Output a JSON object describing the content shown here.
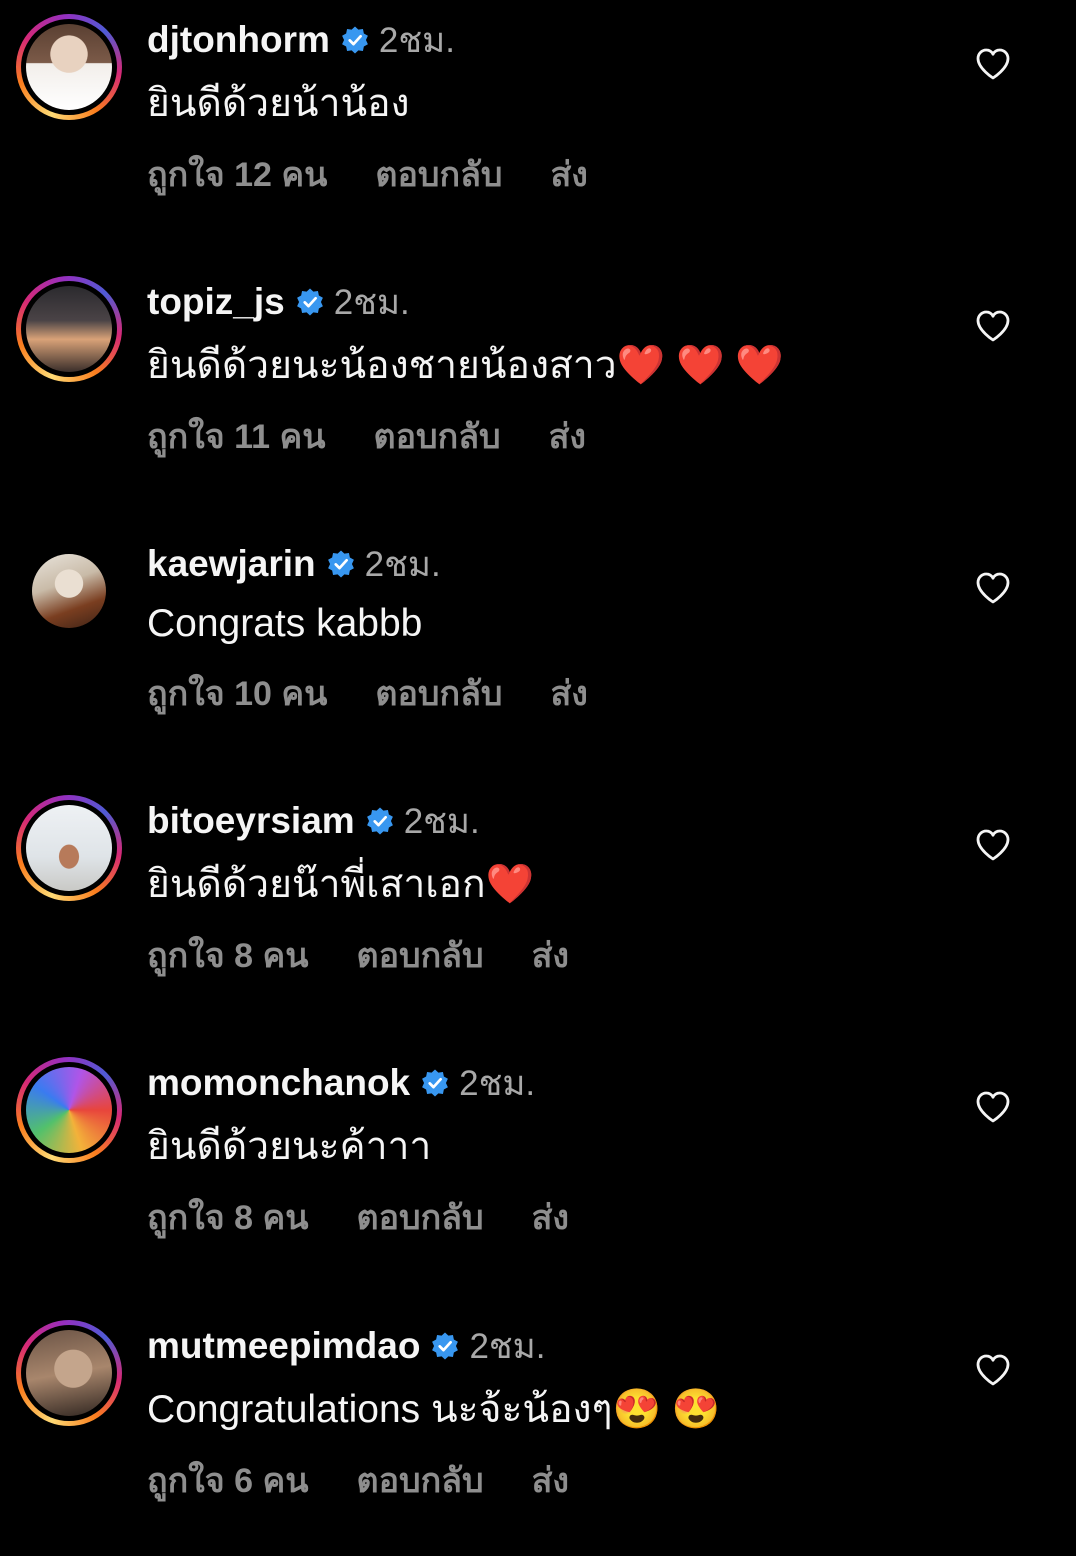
{
  "colors": {
    "background": "#000000",
    "username": "#f5f5f5",
    "meta_gray": "#a8a8a8",
    "actions_gray": "#8e8e8e",
    "verified_blue": "#3897f0"
  },
  "icons": {
    "verified": "verified-badge-icon",
    "like": "heart-outline-icon"
  },
  "comments": [
    {
      "username": "djtonhorm",
      "time": "2ชม.",
      "text": "ยินดีด้วยน้าน้อง",
      "likes": "ถูกใจ 12 คน",
      "reply": "ตอบกลับ",
      "send": "ส่ง",
      "has_story_ring": true
    },
    {
      "username": "topiz_js",
      "time": "2ชม.",
      "text": "ยินดีด้วยนะน้องชายน้องสาว❤️ ❤️ ❤️",
      "likes": "ถูกใจ 11 คน",
      "reply": "ตอบกลับ",
      "send": "ส่ง",
      "has_story_ring": true
    },
    {
      "username": "kaewjarin",
      "time": "2ชม.",
      "text": "Congrats kabbb",
      "likes": "ถูกใจ 10 คน",
      "reply": "ตอบกลับ",
      "send": "ส่ง",
      "has_story_ring": false
    },
    {
      "username": "bitoeyrsiam",
      "time": "2ชม.",
      "text": "ยินดีด้วยน๊าพี่เสาเอก❤️",
      "likes": "ถูกใจ 8 คน",
      "reply": "ตอบกลับ",
      "send": "ส่ง",
      "has_story_ring": true
    },
    {
      "username": "momonchanok",
      "time": "2ชม.",
      "text": "ยินดีด้วยนะค้าาา",
      "likes": "ถูกใจ 8 คน",
      "reply": "ตอบกลับ",
      "send": "ส่ง",
      "has_story_ring": true
    },
    {
      "username": "mutmeepimdao",
      "time": "2ชม.",
      "text": "Congratulations นะจ้ะน้องๆ😍 😍",
      "likes": "ถูกใจ 6 คน",
      "reply": "ตอบกลับ",
      "send": "ส่ง",
      "has_story_ring": true
    }
  ]
}
